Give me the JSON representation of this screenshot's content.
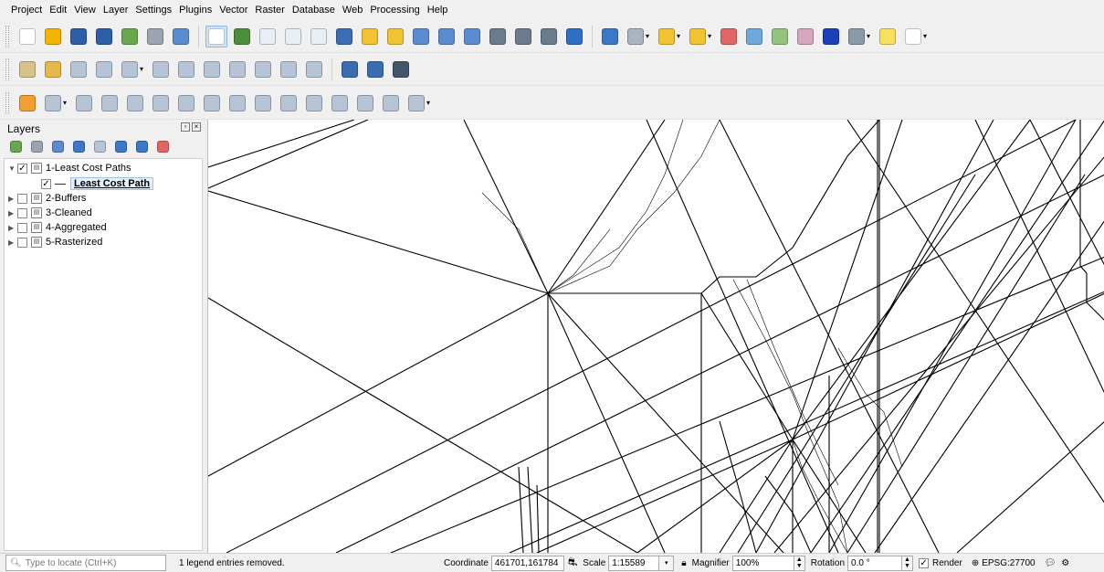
{
  "menu": [
    "Project",
    "Edit",
    "View",
    "Layer",
    "Settings",
    "Plugins",
    "Vector",
    "Raster",
    "Database",
    "Web",
    "Processing",
    "Help"
  ],
  "toolbar1": [
    {
      "name": "new-project-icon",
      "color": "#ffffff"
    },
    {
      "name": "open-project-icon",
      "color": "#f4b400"
    },
    {
      "name": "save-project-icon",
      "color": "#2d5fa8"
    },
    {
      "name": "save-as-icon",
      "color": "#2d5fa8"
    },
    {
      "name": "new-print-layout-icon",
      "color": "#6aa84f"
    },
    {
      "name": "layout-manager-icon",
      "color": "#9aa5b1"
    },
    {
      "name": "style-manager-icon",
      "color": "#5b8bd0"
    },
    {
      "name": "sep"
    },
    {
      "name": "pan-hand-icon",
      "color": "#ffffff",
      "selected": true
    },
    {
      "name": "pan-to-selection-icon",
      "color": "#4c8f3b"
    },
    {
      "name": "zoom-in-icon",
      "color": "#e8eef5"
    },
    {
      "name": "zoom-out-icon",
      "color": "#e8eef5"
    },
    {
      "name": "zoom-rubber-icon",
      "color": "#e8eef5"
    },
    {
      "name": "zoom-full-icon",
      "color": "#3b6db5"
    },
    {
      "name": "zoom-to-selection-icon",
      "color": "#f1c232"
    },
    {
      "name": "zoom-to-layer-icon",
      "color": "#f1c232"
    },
    {
      "name": "zoom-native-icon",
      "color": "#5b8bd0"
    },
    {
      "name": "zoom-last-icon",
      "color": "#5b8bd0"
    },
    {
      "name": "zoom-next-icon",
      "color": "#5b8bd0"
    },
    {
      "name": "new-map-view-icon",
      "color": "#6a7b8c"
    },
    {
      "name": "new-3d-view-icon",
      "color": "#6a7b8c"
    },
    {
      "name": "bookmarks-icon",
      "color": "#6a7b8c"
    },
    {
      "name": "refresh-icon",
      "color": "#2d6fc4"
    },
    {
      "name": "sep"
    },
    {
      "name": "identify-icon",
      "color": "#3d78c8"
    },
    {
      "name": "run-action-icon",
      "color": "#a8b4c0",
      "dropdown": true
    },
    {
      "name": "select-features-icon",
      "color": "#f1c232",
      "dropdown": true
    },
    {
      "name": "select-by-value-icon",
      "color": "#f1c232",
      "dropdown": true
    },
    {
      "name": "deselect-icon",
      "color": "#e06666"
    },
    {
      "name": "attribute-table-icon",
      "color": "#6fa8dc"
    },
    {
      "name": "field-calculator-icon",
      "color": "#93c47d"
    },
    {
      "name": "processing-toolbox-icon",
      "color": "#d5a6bd"
    },
    {
      "name": "statistics-sigma-icon",
      "color": "#1a3fb8"
    },
    {
      "name": "measure-line-icon",
      "color": "#8a9aa8",
      "dropdown": true
    },
    {
      "name": "map-tips-icon",
      "color": "#f6e05e"
    },
    {
      "name": "text-annotation-icon",
      "color": "#ffffff",
      "dropdown": true
    }
  ],
  "toolbar2": [
    {
      "name": "current-edits-icon",
      "color": "#d6c38a"
    },
    {
      "name": "toggle-editing-icon",
      "color": "#e4b94a"
    },
    {
      "name": "save-edits-icon",
      "color": "#b7c4d6"
    },
    {
      "name": "add-line-feature-icon",
      "color": "#b7c4d6"
    },
    {
      "name": "vertex-tool-icon",
      "color": "#b7c4d6",
      "dropdown": true
    },
    {
      "name": "modify-attributes-icon",
      "color": "#b7c4d6"
    },
    {
      "name": "delete-selected-icon",
      "color": "#b7c4d6"
    },
    {
      "name": "cut-features-icon",
      "color": "#b7c4d6"
    },
    {
      "name": "copy-features-icon",
      "color": "#b7c4d6"
    },
    {
      "name": "paste-features-icon",
      "color": "#b7c4d6"
    },
    {
      "name": "undo-icon",
      "color": "#b7c4d6"
    },
    {
      "name": "redo-icon",
      "color": "#b7c4d6"
    },
    {
      "name": "sep"
    },
    {
      "name": "label-toolbar-icon-1",
      "color": "#3a6cb0"
    },
    {
      "name": "label-toolbar-icon-2",
      "color": "#3a6cb0"
    },
    {
      "name": "label-toolbar-icon-3",
      "color": "#44546a"
    }
  ],
  "toolbar3": [
    {
      "name": "digitize-triangle-icon",
      "color": "#f0a030"
    },
    {
      "name": "add-ring-icon",
      "color": "#b7c4d6",
      "dropdown": true
    },
    {
      "name": "add-part-icon",
      "color": "#b7c4d6"
    },
    {
      "name": "fill-ring-icon",
      "color": "#b7c4d6"
    },
    {
      "name": "delete-ring-icon",
      "color": "#b7c4d6"
    },
    {
      "name": "delete-part-icon",
      "color": "#b7c4d6"
    },
    {
      "name": "reshape-icon",
      "color": "#b7c4d6"
    },
    {
      "name": "offset-curve-icon",
      "color": "#b7c4d6"
    },
    {
      "name": "reverse-line-icon",
      "color": "#b7c4d6"
    },
    {
      "name": "simplify-icon",
      "color": "#b7c4d6"
    },
    {
      "name": "split-features-icon",
      "color": "#b7c4d6"
    },
    {
      "name": "split-parts-icon",
      "color": "#b7c4d6"
    },
    {
      "name": "merge-features-icon",
      "color": "#b7c4d6"
    },
    {
      "name": "merge-attributes-icon",
      "color": "#b7c4d6"
    },
    {
      "name": "rotate-point-icon",
      "color": "#b7c4d6"
    },
    {
      "name": "offset-point-icon",
      "color": "#b7c4d6",
      "dropdown": true
    }
  ],
  "layers_panel": {
    "title": "Layers",
    "tools": [
      {
        "name": "open-layer-styling-icon",
        "color": "#6aa84f"
      },
      {
        "name": "add-group-icon",
        "color": "#9aa5b1"
      },
      {
        "name": "manage-visibility-icon",
        "color": "#5b8bd0"
      },
      {
        "name": "filter-legend-icon",
        "color": "#3d78c8"
      },
      {
        "name": "filter-expression-icon",
        "color": "#b7c4d6"
      },
      {
        "name": "expand-all-icon",
        "color": "#3d78c8"
      },
      {
        "name": "collapse-all-icon",
        "color": "#3d78c8"
      },
      {
        "name": "remove-layer-icon",
        "color": "#e06666"
      }
    ],
    "groups": [
      {
        "label": "1-Least Cost Paths",
        "checked": true,
        "expanded": true
      },
      {
        "label": "2-Buffers",
        "checked": false,
        "expanded": false
      },
      {
        "label": "3-Cleaned",
        "checked": false,
        "expanded": false
      },
      {
        "label": "4-Aggregated",
        "checked": false,
        "expanded": false
      },
      {
        "label": "5-Rasterized",
        "checked": false,
        "expanded": false
      }
    ],
    "child_layer": {
      "label": "Least Cost Path",
      "checked": true
    }
  },
  "status": {
    "locator_placeholder": "Type to locate (Ctrl+K)",
    "message": "1 legend entries removed.",
    "coordinate_label": "Coordinate",
    "coordinate_value": "461701,161784",
    "scale_label": "Scale",
    "scale_value": "1:15589",
    "magnifier_label": "Magnifier",
    "magnifier_value": "100%",
    "rotation_label": "Rotation",
    "rotation_value": "0.0 °",
    "render_label": "Render",
    "render_checked": true,
    "crs": "EPSG:27700"
  }
}
